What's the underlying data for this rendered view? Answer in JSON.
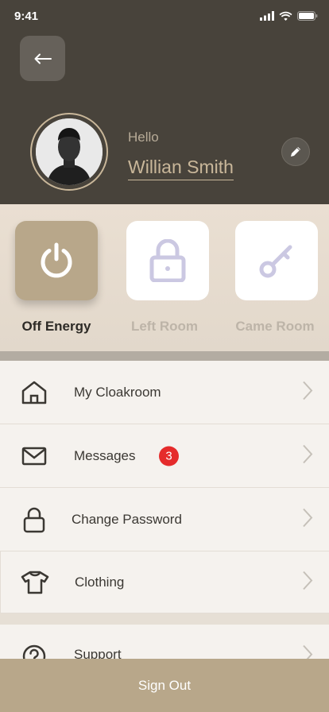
{
  "status_bar": {
    "time": "9:41"
  },
  "header": {
    "greeting": "Hello",
    "user_name": "Willian Smith"
  },
  "quick_actions": [
    {
      "label": "Off Energy",
      "icon": "power-icon",
      "active": true
    },
    {
      "label": "Left Room",
      "icon": "lock-icon",
      "active": false
    },
    {
      "label": "Came Room",
      "icon": "key-icon",
      "active": false
    }
  ],
  "menu": [
    {
      "label": "My Cloakroom",
      "icon": "home-icon"
    },
    {
      "label": "Messages",
      "icon": "mail-icon",
      "badge": "3"
    },
    {
      "label": "Change Password",
      "icon": "lock-icon"
    },
    {
      "label": "Clothing",
      "icon": "tshirt-icon"
    },
    {
      "label": "Support",
      "icon": "help-icon"
    }
  ],
  "footer": {
    "sign_out_label": "Sign Out"
  },
  "colors": {
    "header_bg": "#48433b",
    "accent": "#b8a78a",
    "badge": "#e52b2b"
  }
}
